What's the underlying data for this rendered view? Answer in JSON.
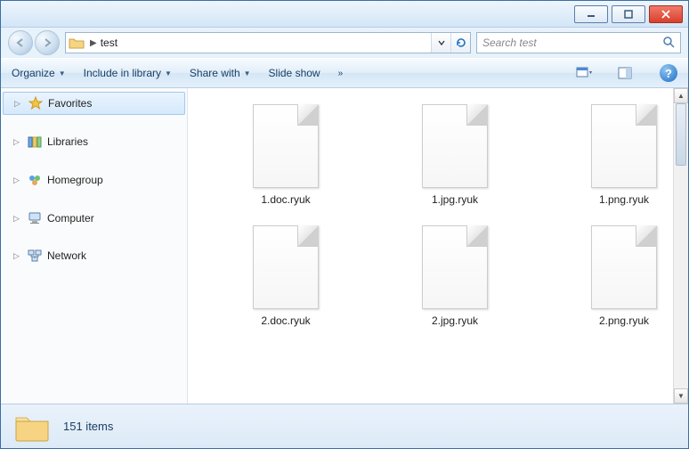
{
  "breadcrumb": {
    "folder": "test"
  },
  "search": {
    "placeholder": "Search test"
  },
  "cmdbar": {
    "organize": "Organize",
    "include": "Include in library",
    "share": "Share with",
    "slideshow": "Slide show"
  },
  "nav": {
    "favorites": "Favorites",
    "libraries": "Libraries",
    "homegroup": "Homegroup",
    "computer": "Computer",
    "network": "Network"
  },
  "files": [
    "1.doc.ryuk",
    "1.jpg.ryuk",
    "1.png.ryuk",
    "2.doc.ryuk",
    "2.jpg.ryuk",
    "2.png.ryuk"
  ],
  "status": {
    "count": "151 items"
  }
}
